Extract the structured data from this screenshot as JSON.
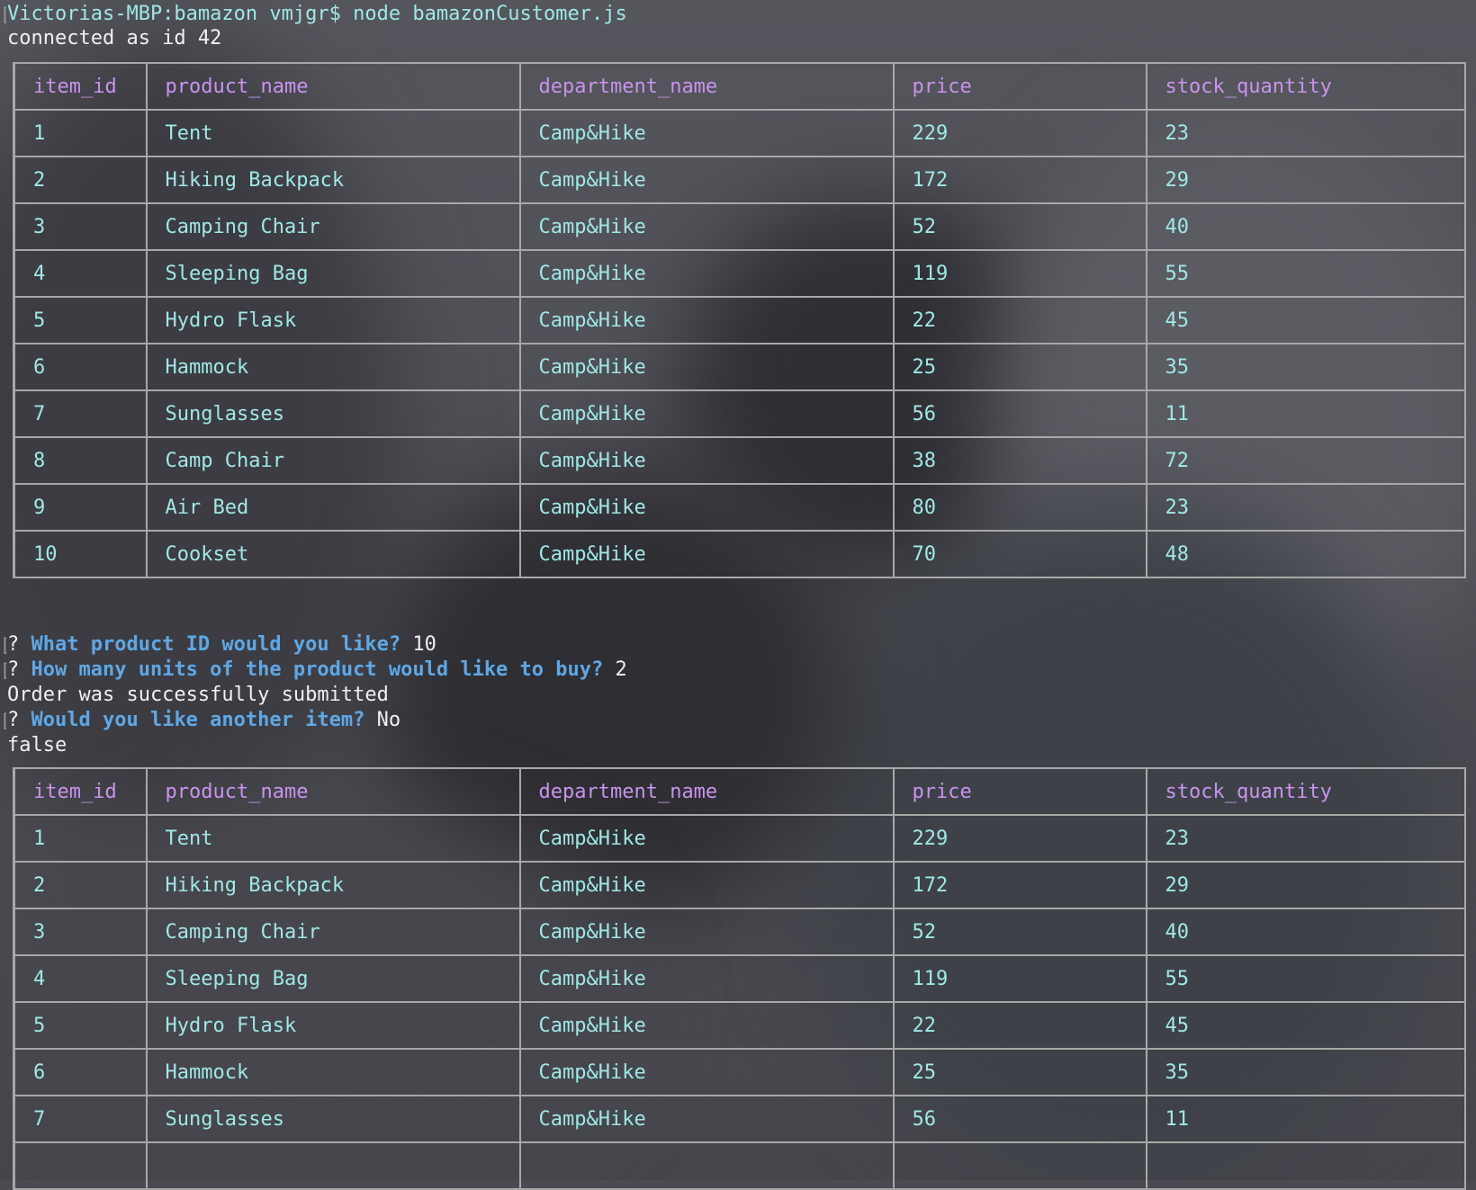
{
  "terminal": {
    "prompt_line": "Victorias-MBP:bamazon vmjgr$ node bamazonCustomer.js",
    "connected_line": "connected as id 42",
    "question_mark": "?",
    "q1": {
      "question": "What product ID would you like?",
      "answer": "10"
    },
    "q2": {
      "question": "How many units of the product would like to buy?",
      "answer": "2"
    },
    "order_line": "Order was successfully submitted",
    "q3": {
      "question": "Would you like another item?",
      "answer": "No"
    },
    "false_line": "false"
  },
  "table": {
    "columns": [
      "item_id",
      "product_name",
      "department_name",
      "price",
      "stock_quantity"
    ]
  },
  "table1": {
    "rows": [
      [
        "1",
        "Tent",
        "Camp&Hike",
        "229",
        "23"
      ],
      [
        "2",
        "Hiking Backpack",
        "Camp&Hike",
        "172",
        "29"
      ],
      [
        "3",
        "Camping Chair",
        "Camp&Hike",
        "52",
        "40"
      ],
      [
        "4",
        "Sleeping Bag",
        "Camp&Hike",
        "119",
        "55"
      ],
      [
        "5",
        "Hydro Flask",
        "Camp&Hike",
        "22",
        "45"
      ],
      [
        "6",
        "Hammock",
        "Camp&Hike",
        "25",
        "35"
      ],
      [
        "7",
        "Sunglasses",
        "Camp&Hike",
        "56",
        "11"
      ],
      [
        "8",
        "Camp Chair",
        "Camp&Hike",
        "38",
        "72"
      ],
      [
        "9",
        "Air Bed",
        "Camp&Hike",
        "80",
        "23"
      ],
      [
        "10",
        "Cookset",
        "Camp&Hike",
        "70",
        "48"
      ]
    ]
  },
  "table2": {
    "rows": [
      [
        "1",
        "Tent",
        "Camp&Hike",
        "229",
        "23"
      ],
      [
        "2",
        "Hiking Backpack",
        "Camp&Hike",
        "172",
        "29"
      ],
      [
        "3",
        "Camping Chair",
        "Camp&Hike",
        "52",
        "40"
      ],
      [
        "4",
        "Sleeping Bag",
        "Camp&Hike",
        "119",
        "55"
      ],
      [
        "5",
        "Hydro Flask",
        "Camp&Hike",
        "22",
        "45"
      ],
      [
        "6",
        "Hammock",
        "Camp&Hike",
        "25",
        "35"
      ],
      [
        "7",
        "Sunglasses",
        "Camp&Hike",
        "56",
        "11"
      ]
    ]
  },
  "colors": {
    "text_default": "#f0f0f0",
    "text_cyan": "#9fe8e6",
    "header_purple": "#c993ee",
    "question_blue": "#5ea8e6",
    "border_gray": "#a8a8a8"
  }
}
